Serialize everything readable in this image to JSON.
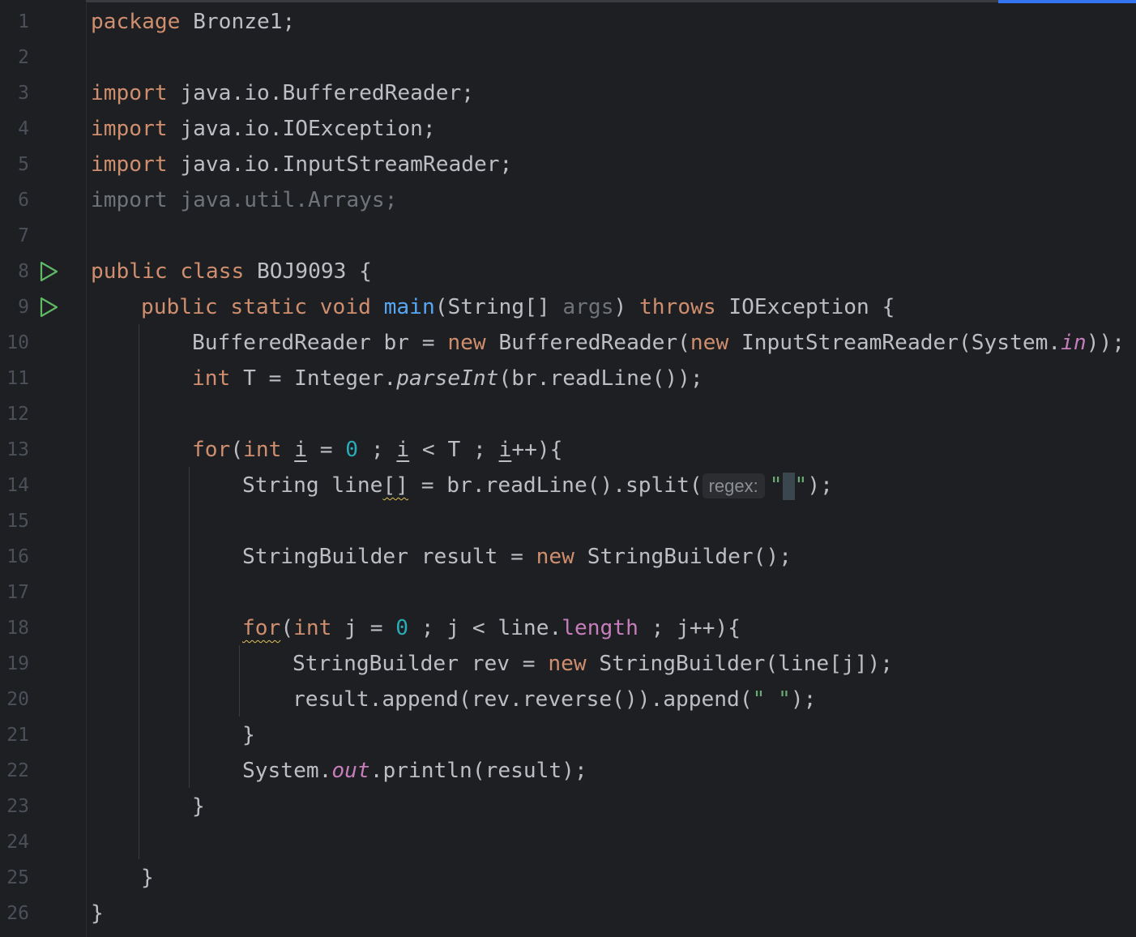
{
  "editor": {
    "line_numbers": [
      "1",
      "2",
      "3",
      "4",
      "5",
      "6",
      "7",
      "8",
      "9",
      "10",
      "11",
      "12",
      "13",
      "14",
      "15",
      "16",
      "17",
      "18",
      "19",
      "20",
      "21",
      "22",
      "23",
      "24",
      "25",
      "26"
    ],
    "gutter_run_icons": [
      "run-gutter-icon",
      "run-gutter-icon"
    ],
    "tokens": {
      "package": "package",
      "package_name": " Bronze1;",
      "import": "import",
      "import_1": " java.io.BufferedReader;",
      "import_2": " java.io.IOException;",
      "import_3": " java.io.InputStreamReader;",
      "import_4_full": "import java.util.Arrays;",
      "public": "public",
      "class": "class",
      "class_name": " BOJ9093 {",
      "static": "static",
      "void": "void",
      "main": "main",
      "string_arr": "(String[] ",
      "args": "args",
      "paren_close": ") ",
      "throws": "throws",
      "ioexception_open": " IOException {",
      "l10_a": "BufferedReader br = ",
      "new": "new",
      "l10_b": " BufferedReader(",
      "l10_c": " InputStreamReader(System.",
      "in": "in",
      "l10_d": "));",
      "int": "int",
      "l11_a": " T = Integer.",
      "parseInt": "parseInt",
      "l11_b": "(br.readLine());",
      "for": "for",
      "open_paren": "(",
      "i": "i",
      "eq": " = ",
      "zero": "0",
      "semi_sp": " ; ",
      "lt_T": " < T ; ",
      "incr_close": "++){",
      "l14_a": "String line",
      "brackets": "[]",
      "l14_b": " = br.readLine().split(",
      "hint_regex": "regex:",
      "quote_open": "\"",
      "quote_close": "\"",
      "l14_end": ");",
      "l16_a": "StringBuilder result = ",
      "l16_b": " StringBuilder();",
      "l18_j": " j = ",
      "l18_b": " ; j < line.",
      "length": "length",
      "l18_c": " ; j++){",
      "l19_a": "StringBuilder rev = ",
      "l19_b": " StringBuilder(line[j]);",
      "l20_a": "result.append(rev.reverse()).append(",
      "space_str": "\" \"",
      "brace_close": "}",
      "l22_a": "System.",
      "out": "out",
      "l22_b": ".println(result);"
    }
  }
}
